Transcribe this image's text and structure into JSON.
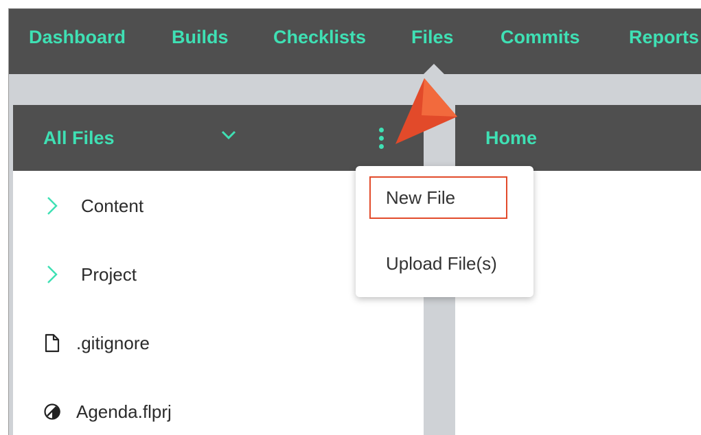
{
  "nav": {
    "items": [
      {
        "label": "Dashboard"
      },
      {
        "label": "Builds"
      },
      {
        "label": "Checklists"
      },
      {
        "label": "Files"
      },
      {
        "label": "Commits"
      },
      {
        "label": "Reports"
      }
    ],
    "active": "Files"
  },
  "left_panel": {
    "header_label": "All Files",
    "dropdown_icon": "chevron-down-icon",
    "menu_icon": "kebab-menu-icon",
    "tree": [
      {
        "label": "Content",
        "icon": "chevron-right-icon"
      },
      {
        "label": "Project",
        "icon": "chevron-right-icon"
      },
      {
        "label": ".gitignore",
        "icon": "file-icon"
      },
      {
        "label": "Agenda.flprj",
        "icon": "project-file-icon"
      }
    ]
  },
  "right_panel": {
    "header_label": "Home"
  },
  "context_menu": {
    "items": [
      {
        "label": "New File"
      },
      {
        "label": "Upload File(s)"
      }
    ],
    "highlighted": "New File"
  },
  "colors": {
    "accent": "#3fe0b4",
    "header_bg": "#4f4f4f",
    "workspace_bg": "#cfd2d6",
    "callout": "#e24a2a"
  }
}
